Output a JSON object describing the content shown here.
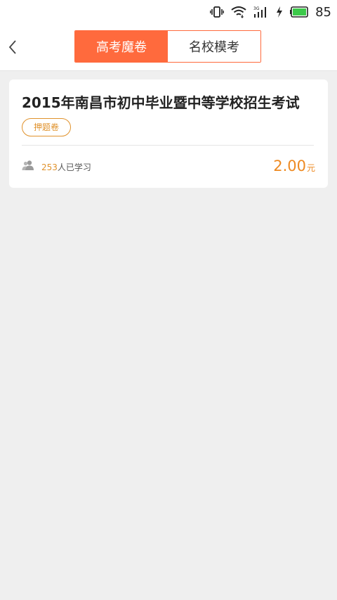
{
  "status_bar": {
    "battery_level": "85",
    "icons": [
      "vibrate-icon",
      "wifi-icon",
      "signal-3g-icon",
      "charging-icon",
      "battery-icon"
    ]
  },
  "header": {
    "tabs": [
      {
        "label": "高考魔卷",
        "active": true
      },
      {
        "label": "名校模考",
        "active": false
      }
    ],
    "accent_color": "#ff6a3d"
  },
  "cards": [
    {
      "title": "2015年南昌市初中毕业暨中等学校招生考试",
      "tag": "押题卷",
      "study_count": "253",
      "study_suffix": "人已学习",
      "price": "2.00",
      "price_unit": "元"
    }
  ]
}
